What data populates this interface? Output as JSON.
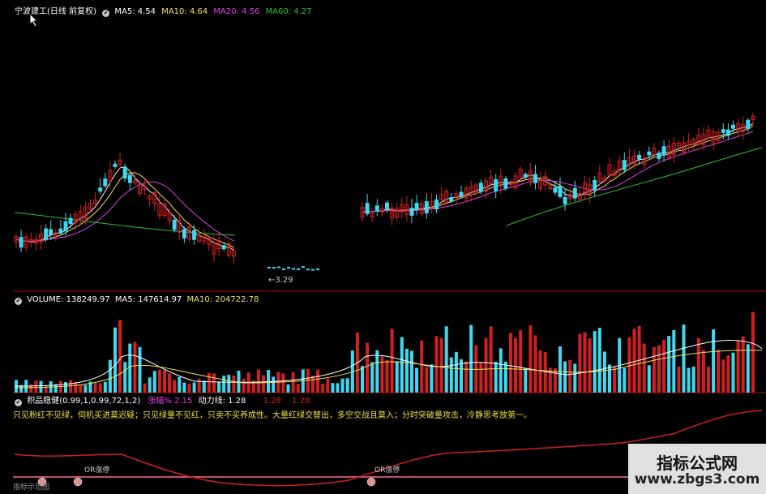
{
  "colors": {
    "up": "#d02020",
    "down": "#40d8f0",
    "ma5": "#ffffff",
    "ma10": "#f0e060",
    "ma20": "#e040e0",
    "ma60": "#30c030",
    "divider": "#b00000",
    "power_line": "#d02020"
  },
  "price_header": {
    "title": "宁波建工(日线 前复权)",
    "ma5": "MA5: 4.54",
    "ma10": "MA10: 4.64",
    "ma20": "MA20: 4.56",
    "ma60": "MA60: 4.27"
  },
  "price_panel": {
    "low_label": "3.29"
  },
  "volume_header": {
    "volume": "VOLUME: 138249.97",
    "ma5": "MA5: 147614.97",
    "ma10": "MA10: 204722.78"
  },
  "indicator_header": {
    "name": "积品稳健",
    "params": "(0.99,1,0.99,72,1,2)",
    "change_label": "涨幅%",
    "change_value": "2.15",
    "power_label": "动力线:",
    "power_value": "1.28",
    "extra1": "1.28",
    "extra2": "1.28"
  },
  "indicator_text": "只见粉红不见绿，伺机买进莫迟疑；只见绿量不见红，只卖不买养成性。大量红绿交替出，多空交战且莫入；分时突破量攻击，冷静思考放第一。",
  "indicator_marks": {
    "or_label_1": "OR涨停",
    "or_label_2": "OR涨停",
    "bottom_left": "指标示范图"
  },
  "watermark": {
    "title": "指标公式网",
    "url": "www.zbgs3.com"
  },
  "chart_data": {
    "type": "candlestick",
    "ma_periods": [
      "MA5",
      "MA10",
      "MA20",
      "MA60"
    ],
    "series": [
      {
        "name": "MA5",
        "last": 4.54
      },
      {
        "name": "MA10",
        "last": 4.64
      },
      {
        "name": "MA20",
        "last": 4.56
      },
      {
        "name": "MA60",
        "last": 4.27
      }
    ],
    "volume": {
      "last": 138249.97,
      "ma5": 147614.97,
      "ma10": 204722.78
    },
    "annotations": [
      "3.29"
    ]
  }
}
